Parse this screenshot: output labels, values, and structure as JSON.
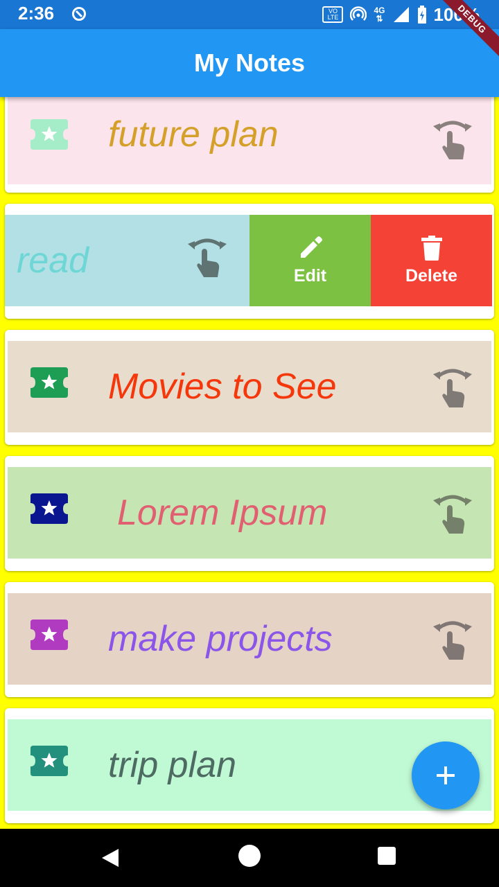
{
  "status_bar": {
    "time": "2:36",
    "volte_top": "VO",
    "volte_bottom": "LTE",
    "network": "4G",
    "battery": "100%",
    "background": "#1976d2"
  },
  "debug_banner": "DEBUG",
  "app_bar": {
    "title": "My Notes",
    "background": "#2196f3"
  },
  "notes": [
    {
      "title": "future plan",
      "tile_color": "#fce4ec",
      "title_color": "#d4a02a",
      "icon_color": "#a5ecc9",
      "icon": "ticket-star-icon"
    },
    {
      "title": "read",
      "tile_color": "#b2e0e4",
      "title_color": "#6fd6d6",
      "swiped": true
    },
    {
      "title": "Movies to See",
      "tile_color": "#e8dccd",
      "title_color": "#f4380c",
      "icon_color": "#1e9d55",
      "icon": "ticket-star-icon"
    },
    {
      "title": "Lorem Ipsum",
      "tile_color": "#c5e6b2",
      "title_color": "#e06072",
      "icon_color": "#0a1690",
      "icon": "ticket-star-icon"
    },
    {
      "title": "make projects",
      "tile_color": "#e5d3c6",
      "title_color": "#8a55e8",
      "icon_color": "#b03bc0",
      "icon": "ticket-star-icon"
    },
    {
      "title": "trip plan",
      "tile_color": "#c0fad4",
      "title_color": "#4d6b62",
      "icon_color": "#23907e",
      "icon": "ticket-star-icon"
    }
  ],
  "actions": {
    "edit_label": "Edit",
    "edit_color": "#7cc142",
    "delete_label": "Delete",
    "delete_color": "#f44336"
  },
  "fab": {
    "icon": "plus-icon",
    "background": "#2196f3"
  }
}
